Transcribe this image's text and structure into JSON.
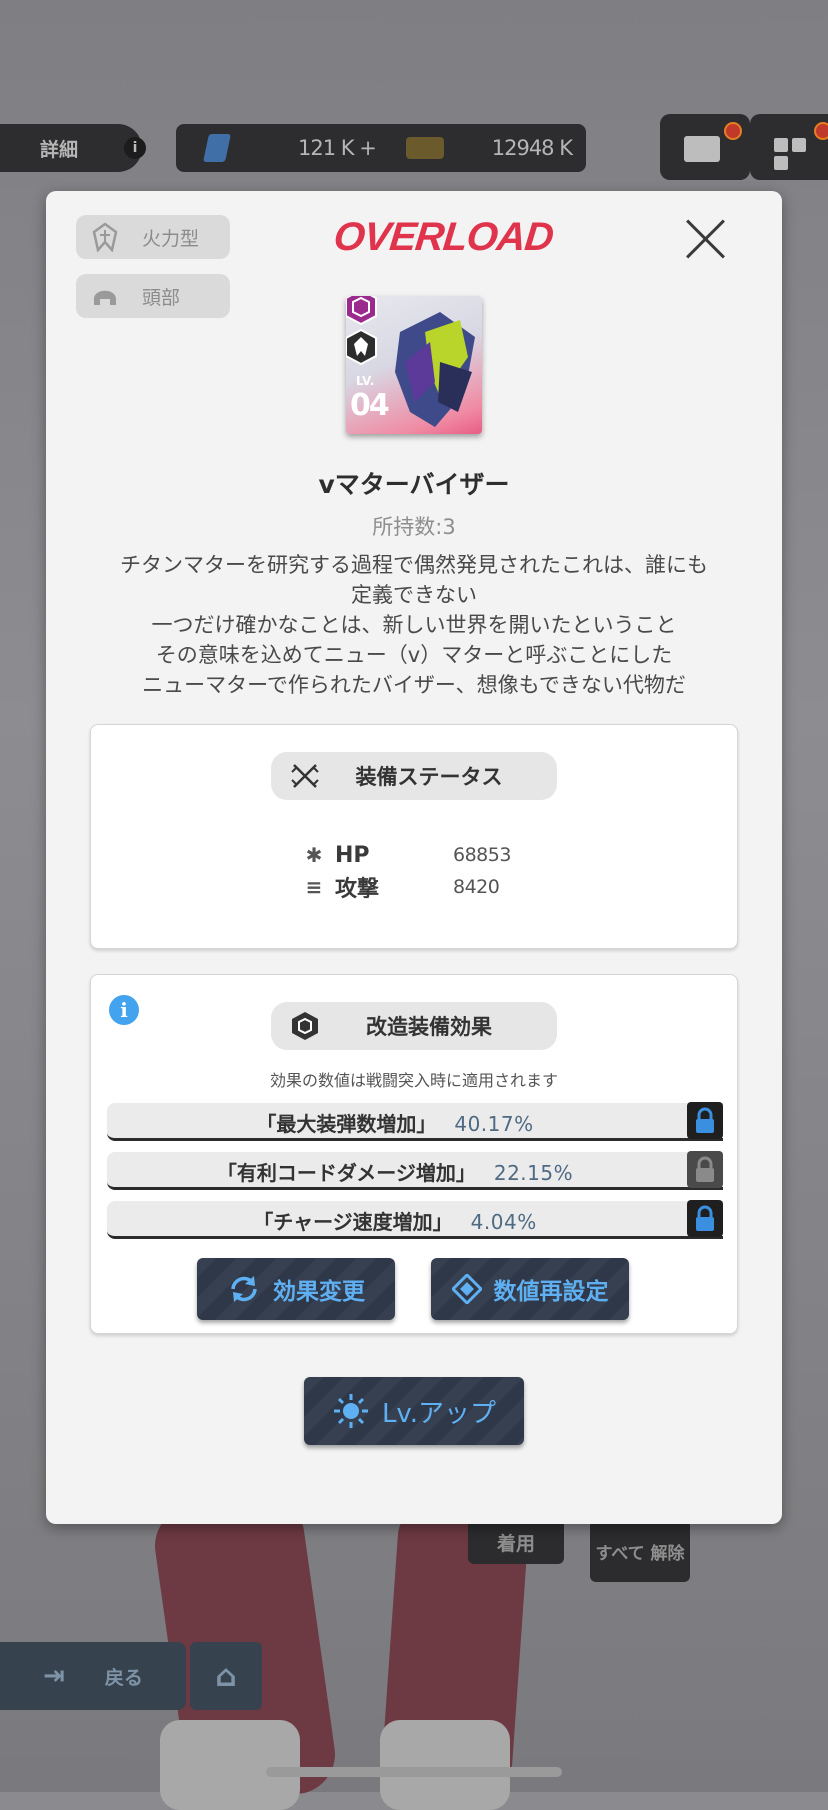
{
  "hud": {
    "detail_label": "詳細",
    "info_glyph": "i",
    "currency_gem": "121 K +",
    "currency_ticket": "12948 K"
  },
  "background": {
    "equip_button": "着用",
    "unequip_button": "すべて 解除",
    "back_button": "戻る"
  },
  "modal": {
    "tags": [
      {
        "label": "火力型",
        "icon": "firepower-type-icon"
      },
      {
        "label": "頭部",
        "icon": "helmet-icon"
      }
    ],
    "brand": "OVERLOAD",
    "item": {
      "level_label": "LV.",
      "level": "04",
      "name": "vマターバイザー",
      "owned": "所持数:3",
      "description": [
        "チタンマターを研究する過程で偶然発見されたこれは、誰にも",
        "定義できない",
        "一つだけ確かなことは、新しい世界を開いたということ",
        "その意味を込めてニュー（v）マターと呼ぶことにした",
        "ニューマターで作られたバイザー、想像もできない代物だ"
      ]
    },
    "status": {
      "title": "装備ステータス",
      "hp_label": "HP",
      "hp_value": "68853",
      "atk_label": "攻撃",
      "atk_value": "8420"
    },
    "modification": {
      "title": "改造装備効果",
      "info_glyph": "i",
      "note": "効果の数値は戦闘突入時に適用されます",
      "effects": [
        {
          "name": "「最大装弾数増加」",
          "value": "40.17%",
          "locked": true
        },
        {
          "name": "「有利コードダメージ増加」",
          "value": "22.15%",
          "locked": false
        },
        {
          "name": "「チャージ速度増加」",
          "value": "4.04%",
          "locked": true
        }
      ],
      "change_button": "効果変更",
      "reset_button": "数値再設定"
    },
    "levelup_button": "Lv.アップ"
  },
  "colors": {
    "brand_red": "#e0344d",
    "accent_blue": "#5fb0f2",
    "lock_blue": "#3a8fe0",
    "button_navy": "#2f3849"
  }
}
